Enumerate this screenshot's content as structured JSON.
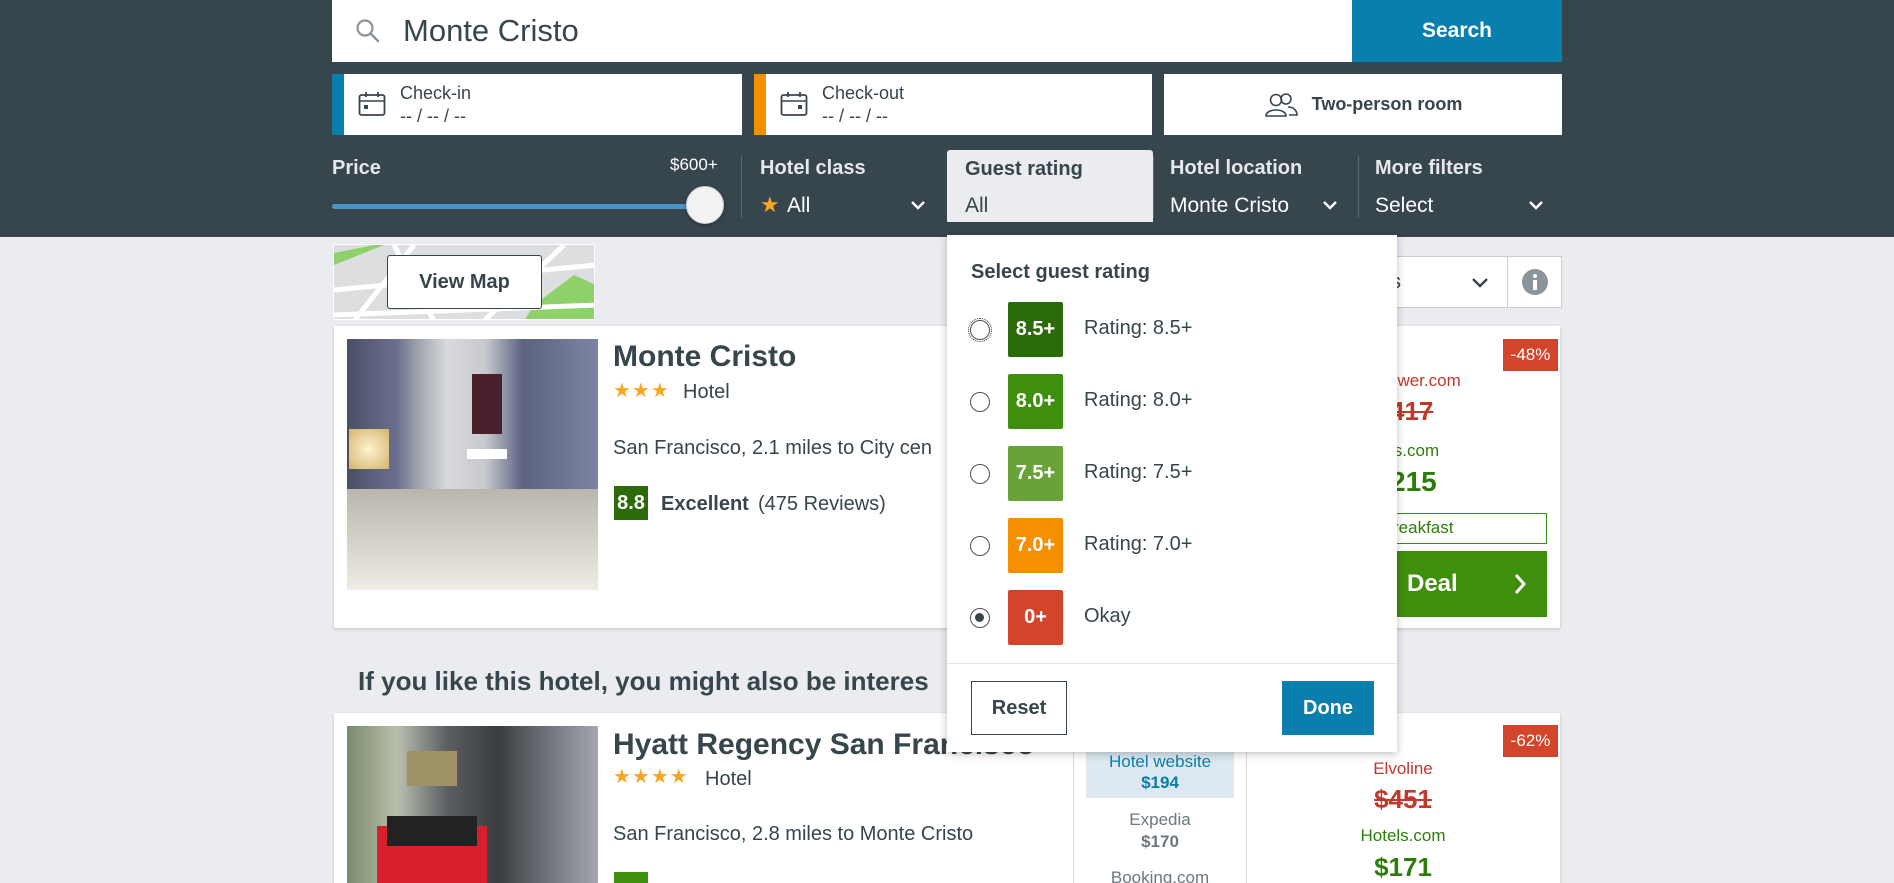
{
  "search": {
    "value": "Monte Cristo",
    "button": "Search"
  },
  "dates": {
    "checkin": {
      "label": "Check-in",
      "value": "-- / -- / --",
      "color": "#0a7ead"
    },
    "checkout": {
      "label": "Check-out",
      "value": "-- / -- / --",
      "color": "#f48f00"
    }
  },
  "room": {
    "label": "Two-person room"
  },
  "filters": {
    "price": {
      "label": "Price",
      "max": "$600+",
      "level": 1.0
    },
    "hotel_class": {
      "label": "Hotel class",
      "value": "All"
    },
    "guest_rating": {
      "label": "Guest rating",
      "value": "All"
    },
    "location": {
      "label": "Hotel location",
      "value": "Monte Cristo"
    },
    "more": {
      "label": "More filters",
      "value": "Select"
    }
  },
  "map": {
    "button": "View Map"
  },
  "sort": {
    "value": "s"
  },
  "dropdown": {
    "title": "Select guest rating",
    "options": [
      {
        "badge": "8.5+",
        "text": "Rating: 8.5+",
        "color": "#2b6b0a",
        "selected": false
      },
      {
        "badge": "8.0+",
        "text": "Rating: 8.0+",
        "color": "#3f8f0f",
        "selected": false
      },
      {
        "badge": "7.5+",
        "text": "Rating: 7.5+",
        "color": "#6aa23a",
        "selected": false
      },
      {
        "badge": "7.0+",
        "text": "Rating: 7.0+",
        "color": "#f48f00",
        "selected": false
      },
      {
        "badge": "0+",
        "text": "Okay",
        "color": "#d3452b",
        "selected": true
      }
    ],
    "reset": "Reset",
    "done": "Done"
  },
  "hotel1": {
    "name": "Monte Cristo",
    "stars": "★★★",
    "type": "Hotel",
    "location": "San Francisco, 2.1 miles to City cen",
    "score": "8.8",
    "score_label": "Excellent",
    "reviews": "(475 Reviews)",
    "discount": "-48%",
    "old_site": "ower.com",
    "old_price": "417",
    "new_site": "ls.com",
    "new_price": "215",
    "perk": "reakfast",
    "deal": "Deal"
  },
  "interest_heading": "If you like this hotel, you might also be interes",
  "hotel2": {
    "name": "Hyatt Regency San Francisco",
    "stars": "★★★★",
    "type": "Hotel",
    "location": "San Francisco, 2.8 miles to Monte Cristo",
    "discount": "-62%",
    "mid_prices": [
      {
        "site": "Hotel website",
        "price": "$194"
      },
      {
        "site": "Expedia",
        "price": "$170"
      },
      {
        "site": "Booking.com",
        "price": ""
      }
    ],
    "old_site": "Elvoline",
    "old_price": "$451",
    "new_site": "Hotels.com",
    "new_price": "$171"
  }
}
